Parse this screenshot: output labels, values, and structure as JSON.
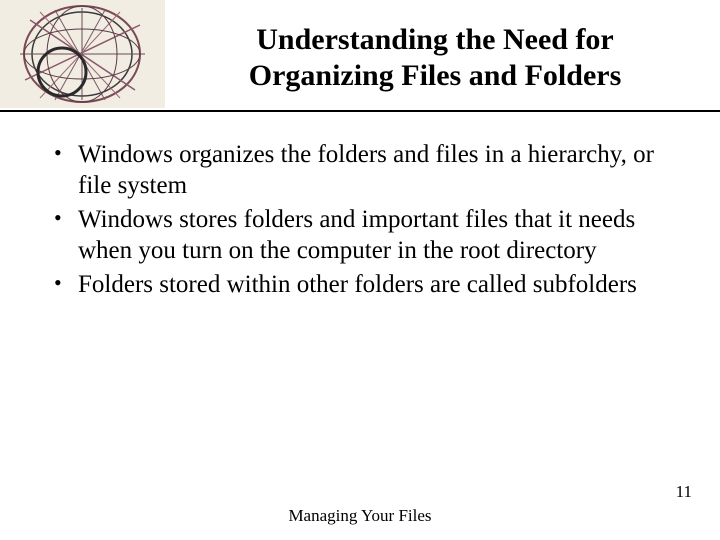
{
  "slide": {
    "title": "Understanding the Need for Organizing Files and Folders",
    "bullets": [
      "Windows organizes the folders and files in a hierarchy, or file system",
      "Windows stores folders and important files that it needs when you turn on the computer in the root directory",
      "Folders stored within other folders are called subfolders"
    ],
    "footer": "Managing Your Files",
    "page_number": "11"
  },
  "icons": {
    "decorative": "abstract-sphere-art"
  }
}
